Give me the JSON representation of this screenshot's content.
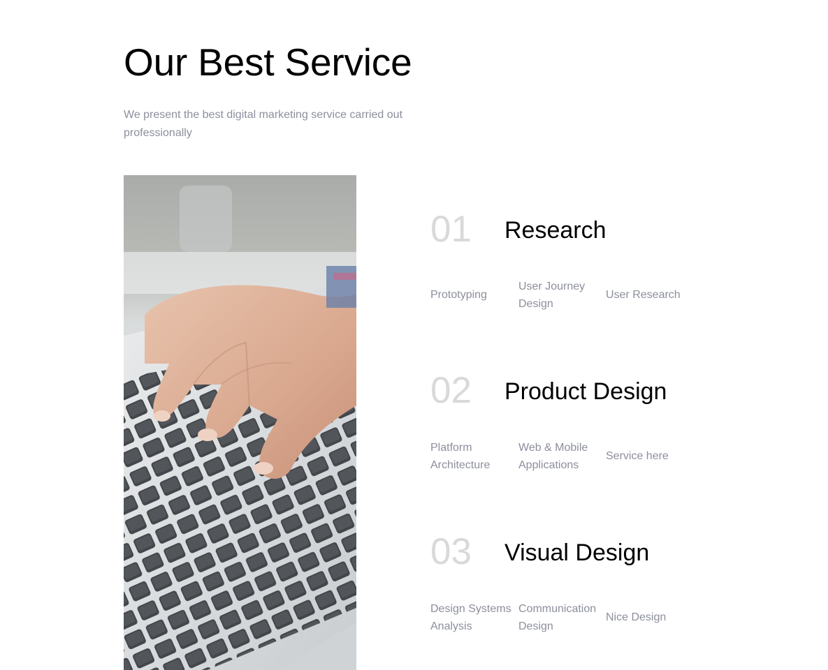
{
  "header": {
    "title": "Our Best Service",
    "subtitle": "We present the best digital marketing service carried out professionally"
  },
  "services": [
    {
      "number": "01",
      "title": "Research",
      "tags": [
        "Prototyping",
        "User Journey Design",
        "User Research"
      ]
    },
    {
      "number": "02",
      "title": "Product Design",
      "tags": [
        "Platform Architecture",
        "Web & Mobile Applications",
        "Service here"
      ]
    },
    {
      "number": "03",
      "title": "Visual Design",
      "tags": [
        "Design Systems Analysis",
        "Communication Design",
        "Nice Design"
      ]
    }
  ],
  "colors": {
    "heading": "#000000",
    "muted_text": "#8c8f9c",
    "number": "#d9d9d9",
    "background": "#ffffff"
  }
}
